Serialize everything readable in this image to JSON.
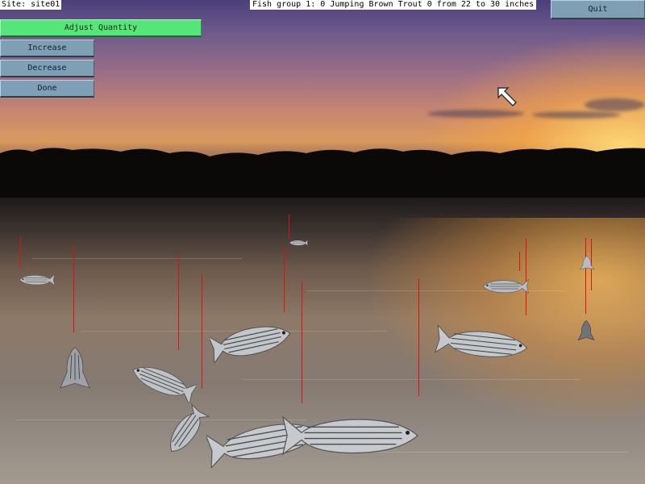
{
  "site_label": "Site: site01",
  "status_text": "Fish group 1: 0 Jumping Brown Trout 0 from 22 to 30 inches",
  "buttons": {
    "adjust": "Adjust Quantity",
    "increase": "Increase",
    "decrease": "Decrease",
    "done": "Done",
    "quit": "Quit"
  },
  "colors": {
    "button": "#7f9fb5",
    "button_active": "#55e57a",
    "fishing_line": "#e01010"
  },
  "icons": {
    "cursor": "arrow-cursor-icon",
    "fish": "striped-bass-icon"
  }
}
